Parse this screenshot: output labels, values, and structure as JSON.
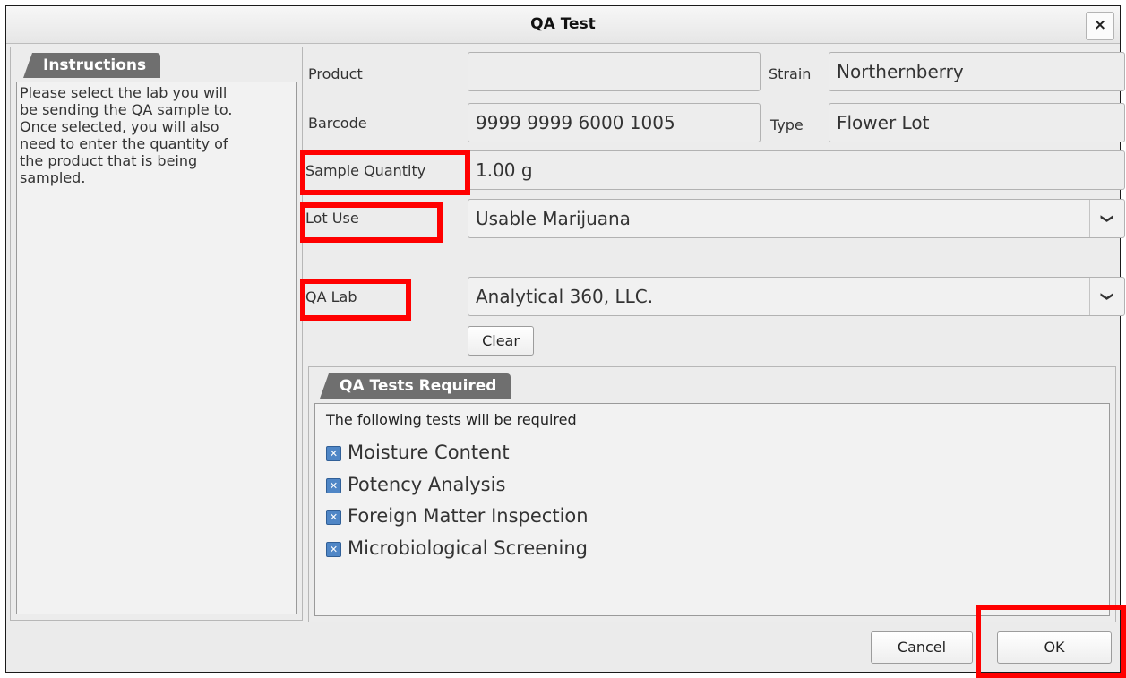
{
  "window": {
    "title": "QA Test",
    "close_label": "×"
  },
  "instructions": {
    "tab_label": "Instructions",
    "lines": [
      "Please select the lab you will",
      "be sending the QA sample to.",
      "Once selected, you will also",
      "need to enter the quantity of",
      "the product that is being",
      "sampled."
    ]
  },
  "form": {
    "product_label": "Product",
    "product_value": "",
    "strain_label": "Strain",
    "strain_value": "Northernberry",
    "barcode_label": "Barcode",
    "barcode_value": "9999 9999 6000 1005",
    "type_label": "Type",
    "type_value": "Flower Lot",
    "sample_quantity_label": "Sample Quantity",
    "sample_quantity_value": "1.00 g",
    "lot_use_label": "Lot Use",
    "lot_use_value": "Usable Marijuana",
    "qa_lab_label": "QA Lab",
    "qa_lab_value": "Analytical 360, LLC.",
    "clear_label": "Clear",
    "chevron": "❯"
  },
  "tests": {
    "tab_label": "QA Tests Required",
    "header": "The following tests will be required",
    "items": [
      {
        "label": "Moisture Content",
        "checked": true
      },
      {
        "label": "Potency Analysis",
        "checked": true
      },
      {
        "label": "Foreign Matter Inspection",
        "checked": true
      },
      {
        "label": "Microbiological Screening",
        "checked": true
      }
    ],
    "check_glyph": "✕"
  },
  "footer": {
    "cancel_label": "Cancel",
    "ok_label": "OK"
  },
  "colors": {
    "highlight": "#ff0000",
    "checkbox": "#4f86c6",
    "tab": "#6f6f6f"
  }
}
